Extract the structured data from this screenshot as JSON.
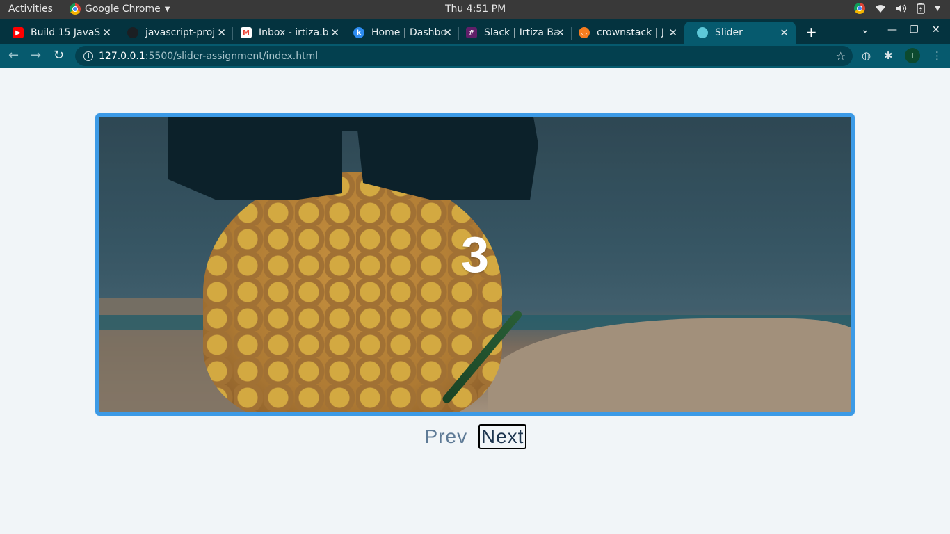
{
  "topbar": {
    "activities": "Activities",
    "app_name": "Google Chrome",
    "clock": "Thu  4:51 PM"
  },
  "tabs": [
    {
      "title": "Build 15 JavaS",
      "favicon": "youtube-icon",
      "color": "#ff0000"
    },
    {
      "title": "javascript-proj",
      "favicon": "github-icon",
      "color": "#1b1f23"
    },
    {
      "title": "Inbox - irtiza.b",
      "favicon": "gmail-icon",
      "color": "#ea4335"
    },
    {
      "title": "Home | Dashbo",
      "favicon": "k-icon",
      "color": "#2d8cf0"
    },
    {
      "title": "Slack | Irtiza Ba",
      "favicon": "slack-icon",
      "color": "#611f69"
    },
    {
      "title": "crownstack | J",
      "favicon": "crownstack-icon",
      "color": "#f57c1f"
    },
    {
      "title": "Slider",
      "favicon": "globe-icon",
      "color": "#5ec8d8"
    }
  ],
  "address_bar": {
    "host": "127.0.0.1",
    "path": ":5500/slider-assignment/index.html"
  },
  "profile_initial": "I",
  "slider": {
    "current_slide": "3",
    "prev_label": "Prev",
    "next_label": "Next",
    "border_color": "#3c9ae6"
  }
}
